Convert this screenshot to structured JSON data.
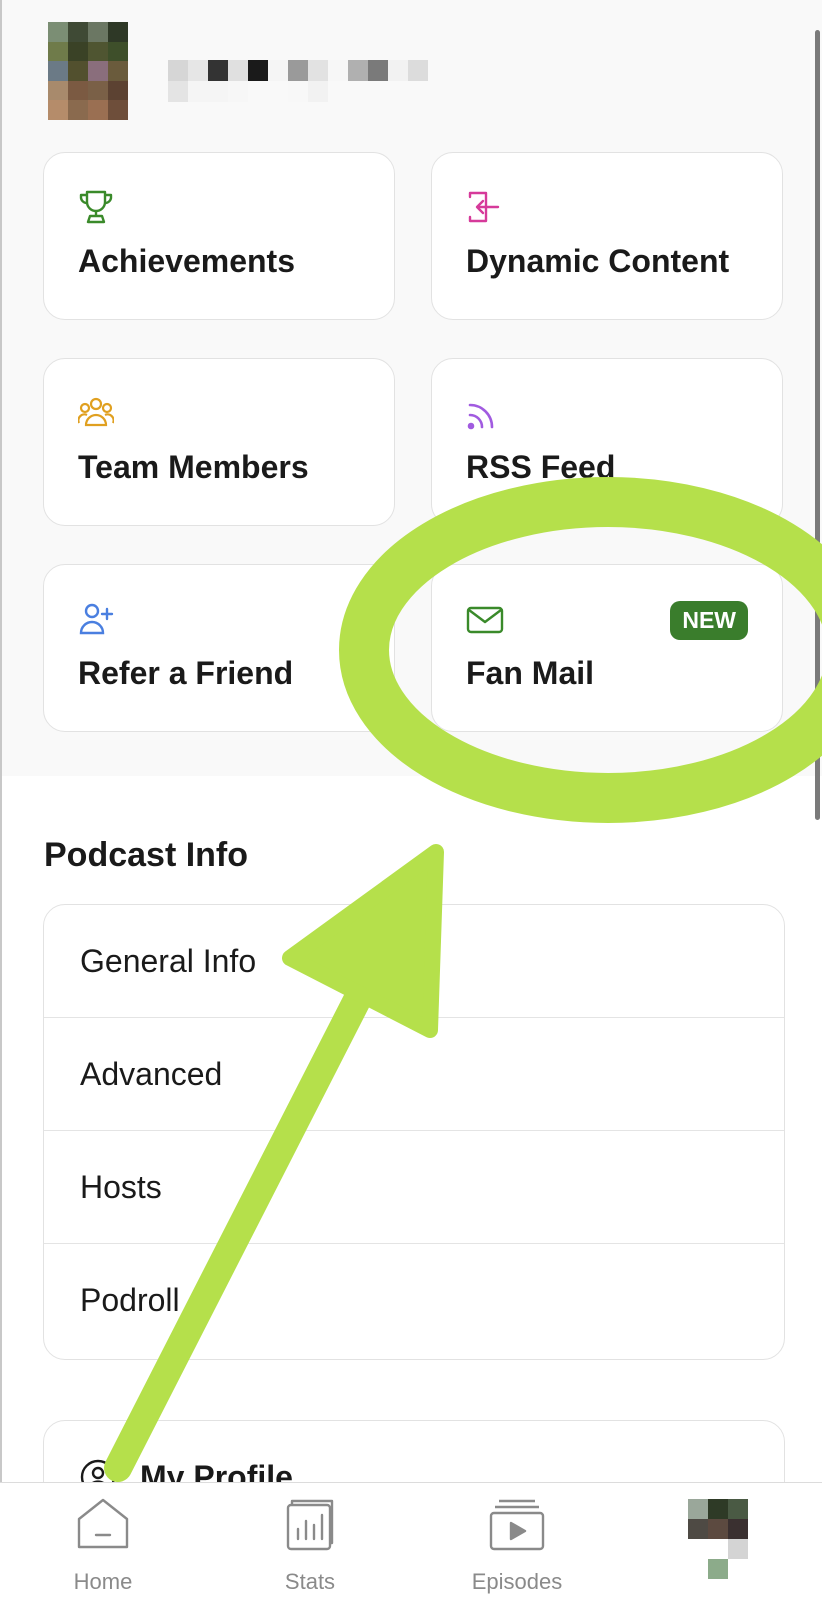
{
  "colors": {
    "accent_green": "#3a7d2c",
    "trophy_icon": "#3a8a2a",
    "dynamic_icon": "#d63a9a",
    "team_icon": "#e0a020",
    "rss_icon": "#a15be0",
    "refer_icon": "#4a7fe0",
    "mail_icon": "#3a8a2a",
    "annotation": "#b5e04b"
  },
  "cards": [
    {
      "label": "Achievements",
      "icon": "trophy-icon"
    },
    {
      "label": "Dynamic Content",
      "icon": "dynamic-content-icon"
    },
    {
      "label": "Team Members",
      "icon": "team-icon"
    },
    {
      "label": "RSS Feed",
      "icon": "rss-icon"
    },
    {
      "label": "Refer a Friend",
      "icon": "add-person-icon"
    },
    {
      "label": "Fan Mail",
      "icon": "mail-icon",
      "badge": "NEW"
    }
  ],
  "podcast_info": {
    "title": "Podcast Info",
    "items": [
      "General Info",
      "Advanced",
      "Hosts",
      "Podroll"
    ]
  },
  "profile": {
    "label": "My Profile"
  },
  "tabs": [
    {
      "label": "Home",
      "icon": "home-icon"
    },
    {
      "label": "Stats",
      "icon": "stats-icon"
    },
    {
      "label": "Episodes",
      "icon": "episodes-icon"
    },
    {
      "label": "",
      "icon": "profile-avatar"
    }
  ]
}
